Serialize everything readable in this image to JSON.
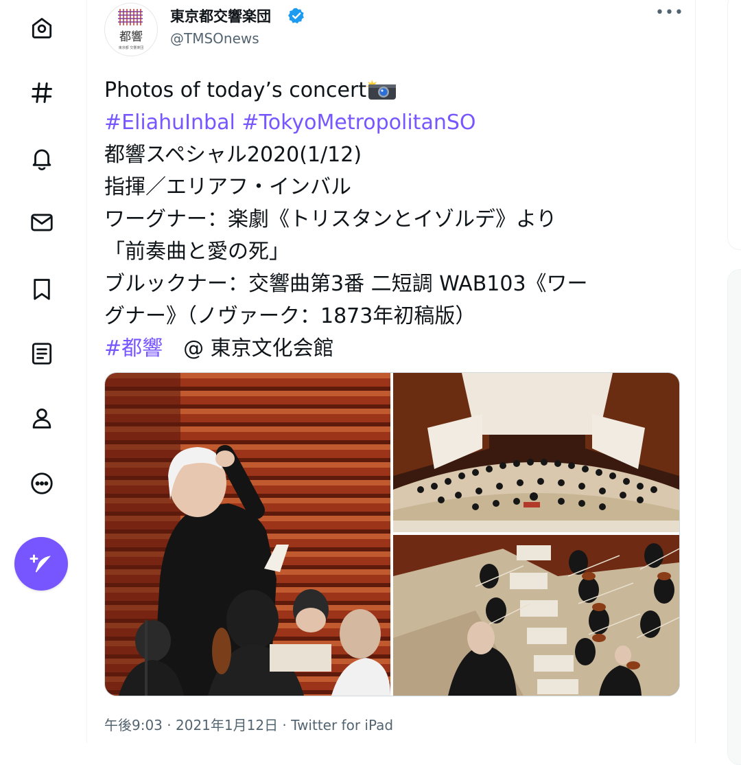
{
  "nav": {
    "items": [
      {
        "name": "home",
        "icon": "home-icon"
      },
      {
        "name": "explore",
        "icon": "hashtag-icon"
      },
      {
        "name": "notifications",
        "icon": "bell-icon"
      },
      {
        "name": "messages",
        "icon": "mail-icon"
      },
      {
        "name": "bookmarks",
        "icon": "bookmark-icon"
      },
      {
        "name": "lists",
        "icon": "list-icon"
      },
      {
        "name": "profile",
        "icon": "person-icon"
      },
      {
        "name": "more",
        "icon": "more-circle-icon"
      }
    ],
    "compose_icon": "feather-plus-icon",
    "accent": "#7856ff"
  },
  "tweet": {
    "author": {
      "name": "東京都交響楽団",
      "handle": "@TMSOnews",
      "verified": true,
      "avatar_text": "都響",
      "avatar_subtext": "東京都 交響楽団"
    },
    "more_label": "•••",
    "text": {
      "line1": "Photos of today’s concert",
      "line1_emoji": "camera-with-flash-icon",
      "hashtag1": "#EliahuInbal",
      "hashtag2": "#TokyoMetropolitanSO",
      "line3": "都響スペシャル2020(1/12)",
      "line4": "指揮／エリアフ・インバル",
      "line5": "ワーグナー：楽劇《トリスタンとイゾルデ》より",
      "line6": "「前奏曲と愛の死」",
      "line7": "ブルックナー：交響曲第3番 二短調 WAB103《ワー",
      "line8": "グナー》（ノヴァーク：1873年初稿版）",
      "hashtag3": "#都響",
      "location": "　@ 東京文化会館"
    },
    "photos": [
      {
        "name": "conductor-photo",
        "alt": "conductor"
      },
      {
        "name": "hall-photo",
        "alt": "orchestra on stage"
      },
      {
        "name": "strings-photo",
        "alt": "strings section"
      }
    ],
    "meta": {
      "time": "午後9:03",
      "sep1": " · ",
      "date": "2021年1月12日",
      "sep2": " · ",
      "source": "Twitter for iPad"
    },
    "colors": {
      "hashtag": "#7856ff",
      "verified": "#1d9bf0",
      "secondary_text": "#536471"
    }
  }
}
